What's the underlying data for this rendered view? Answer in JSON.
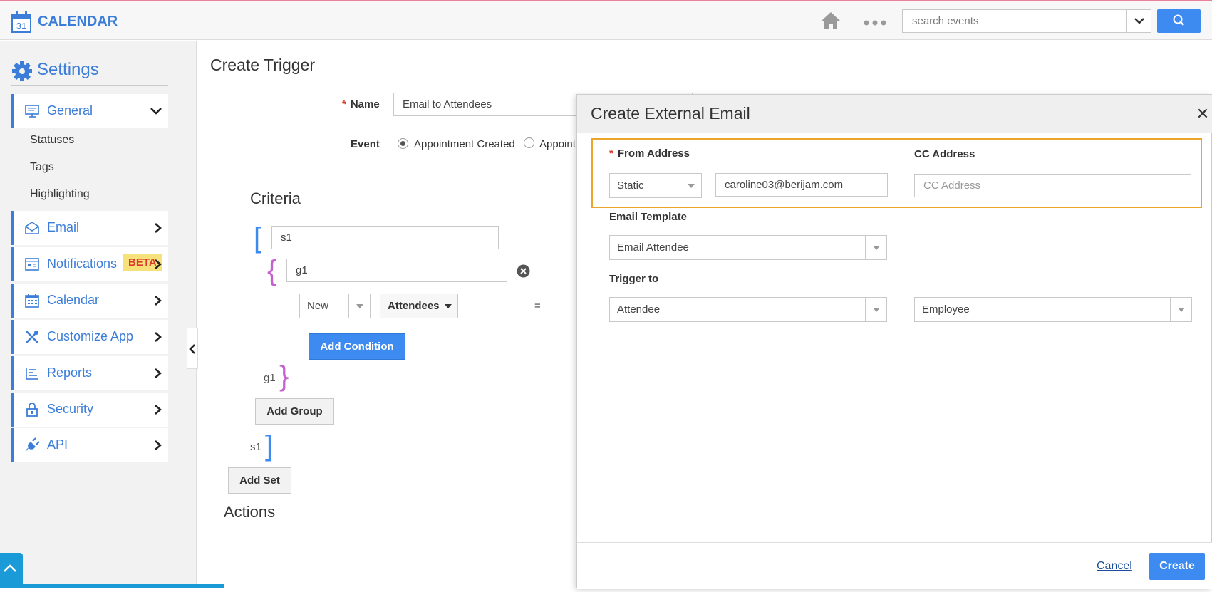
{
  "header": {
    "app_title": "CALENDAR",
    "logo_day": "31",
    "search_placeholder": "search events"
  },
  "sidebar": {
    "title": "Settings",
    "items": [
      {
        "label": "General",
        "icon": "monitor-icon",
        "expanded": true
      },
      {
        "label": "Email",
        "icon": "envelope-icon"
      },
      {
        "label": "Notifications",
        "icon": "notification-icon",
        "badge": "BETA"
      },
      {
        "label": "Calendar",
        "icon": "calendar-icon"
      },
      {
        "label": "Customize App",
        "icon": "tools-icon"
      },
      {
        "label": "Reports",
        "icon": "reports-icon"
      },
      {
        "label": "Security",
        "icon": "lock-icon"
      },
      {
        "label": "API",
        "icon": "plug-icon"
      }
    ],
    "sub_items": [
      "Statuses",
      "Tags",
      "Highlighting"
    ]
  },
  "form": {
    "page_title": "Create Trigger",
    "name_label": "Name",
    "name_value": "Email to Attendees",
    "event_label": "Event",
    "event_options": [
      "Appointment Created",
      "Appoint"
    ],
    "event_selected": 0,
    "criteria_title": "Criteria",
    "set_name": "s1",
    "group_name": "g1",
    "condition_field": "New",
    "condition_module": "Attendees",
    "condition_operator": "=",
    "add_condition": "Add Condition",
    "add_group": "Add Group",
    "add_set": "Add Set",
    "actions_title": "Actions"
  },
  "modal": {
    "title": "Create External Email",
    "from_label": "From Address",
    "from_type": "Static",
    "from_value": "caroline03@berijam.com",
    "cc_label": "CC Address",
    "cc_placeholder": "CC Address",
    "template_label": "Email Template",
    "template_value": "Email Attendee",
    "trigger_label": "Trigger to",
    "trigger_value_1": "Attendee",
    "trigger_value_2": "Employee",
    "cancel": "Cancel",
    "create": "Create"
  },
  "colors": {
    "accent": "#3b7dd8",
    "button_blue": "#3d8bf0",
    "highlight_border": "#eba52b",
    "top_border": "#e8809a",
    "group_brace": "#c65fd0",
    "set_bracket": "#3d8bf0"
  }
}
